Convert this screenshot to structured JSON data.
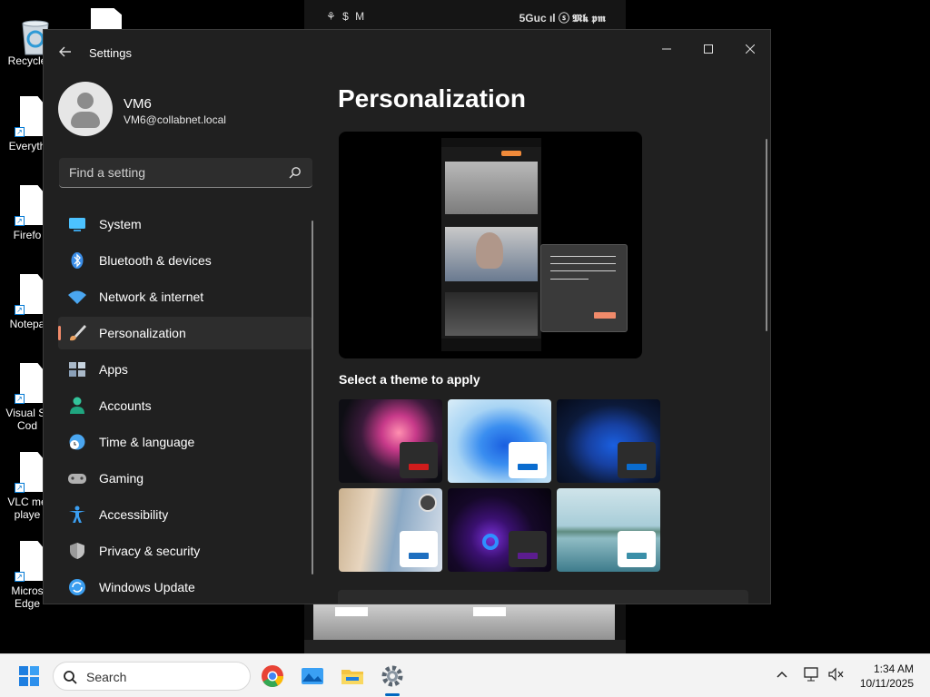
{
  "desktop": {
    "icons": [
      {
        "label": "Recycle"
      },
      {
        "label": "Everyth"
      },
      {
        "label": "Firefo"
      },
      {
        "label": "Notepa"
      },
      {
        "label": "Visual St\nCod"
      },
      {
        "label": "VLC me\nplaye"
      },
      {
        "label": "Micros\nEdge"
      }
    ]
  },
  "phone": {
    "status_left": "⚘ $ M",
    "status_right": "5Guc ıl ⓢ 𝕸𝖐 𝖕𝖒"
  },
  "window": {
    "app_title": "Settings",
    "user": {
      "name": "VM6",
      "email": "VM6@collabnet.local"
    },
    "search_placeholder": "Find a setting",
    "nav": [
      {
        "label": "System",
        "icon": "monitor-icon",
        "color": "#4cc2ff"
      },
      {
        "label": "Bluetooth & devices",
        "icon": "bluetooth-icon",
        "color": "#3b8ee8"
      },
      {
        "label": "Network & internet",
        "icon": "wifi-icon",
        "color": "#4aa6f0"
      },
      {
        "label": "Personalization",
        "icon": "paintbrush-icon",
        "color": "#e8a060",
        "active": true
      },
      {
        "label": "Apps",
        "icon": "apps-icon",
        "color": "#9ab0c8"
      },
      {
        "label": "Accounts",
        "icon": "person-icon",
        "color": "#33c39a"
      },
      {
        "label": "Time & language",
        "icon": "clock-globe-icon",
        "color": "#4aa6f0"
      },
      {
        "label": "Gaming",
        "icon": "gamepad-icon",
        "color": "#b0b0b0"
      },
      {
        "label": "Accessibility",
        "icon": "accessibility-icon",
        "color": "#3b9ef0"
      },
      {
        "label": "Privacy & security",
        "icon": "shield-icon",
        "color": "#9a9a9a"
      },
      {
        "label": "Windows Update",
        "icon": "update-icon",
        "color": "#3b9ef0"
      }
    ],
    "page_title": "Personalization",
    "theme_heading": "Select a theme to apply",
    "themes": [
      {
        "name": "glow",
        "accent": "#d01c1c"
      },
      {
        "name": "windows-light",
        "accent": "#0a6ccf"
      },
      {
        "name": "windows-dark",
        "accent": "#0a6ccf"
      },
      {
        "name": "captured-motion",
        "accent": "#1e6fc0"
      },
      {
        "name": "flow",
        "accent": "#5c1d8f"
      },
      {
        "name": "sunrise",
        "accent": "#3a8fa8"
      }
    ],
    "accent_color": "#f08a6a"
  },
  "taskbar": {
    "search_label": "Search",
    "time": "1:34 AM",
    "date": "10/11/2025"
  }
}
